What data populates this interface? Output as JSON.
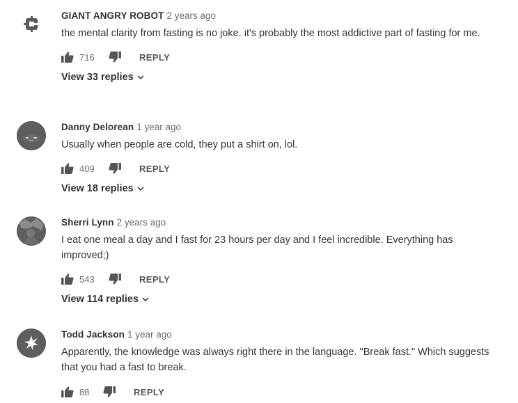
{
  "comments": [
    {
      "author": "GIANT ANGRY ROBOT",
      "time": "2 years ago",
      "text": "the mental clarity from fasting is no joke. it's probably the most addictive part of fasting for me.",
      "likes": "716",
      "reply_label": "REPLY",
      "view_replies": "View 33 replies",
      "avatar_icon": "robot-logo-icon"
    },
    {
      "author": "Danny Delorean",
      "time": "1 year ago",
      "text": "Usually when people are cold, they put a shirt on, lol.",
      "likes": "409",
      "reply_label": "REPLY",
      "view_replies": "View 18 replies",
      "avatar_icon": "user-photo"
    },
    {
      "author": "Sherri Lynn",
      "time": "2 years ago",
      "text": "I eat one meal a day and I fast for 23 hours per day and I feel incredible. Everything has improved;)",
      "likes": "543",
      "reply_label": "REPLY",
      "view_replies": "View 114 replies",
      "avatar_icon": "user-photo"
    },
    {
      "author": "Todd Jackson",
      "time": "1 year ago",
      "text": "Apparently, the knowledge was always right there in the language. \"Break fast.\" Which suggests that you had a fast to break.",
      "likes": "88",
      "reply_label": "REPLY",
      "avatar_icon": "user-photo"
    }
  ],
  "icons": {
    "like": "thumbs-up-icon",
    "dislike": "thumbs-down-icon",
    "expand": "chevron-down-icon"
  },
  "colors": {
    "text": "#333333",
    "secondary": "#6b6b6b",
    "avatar": "#5e5e5e"
  }
}
